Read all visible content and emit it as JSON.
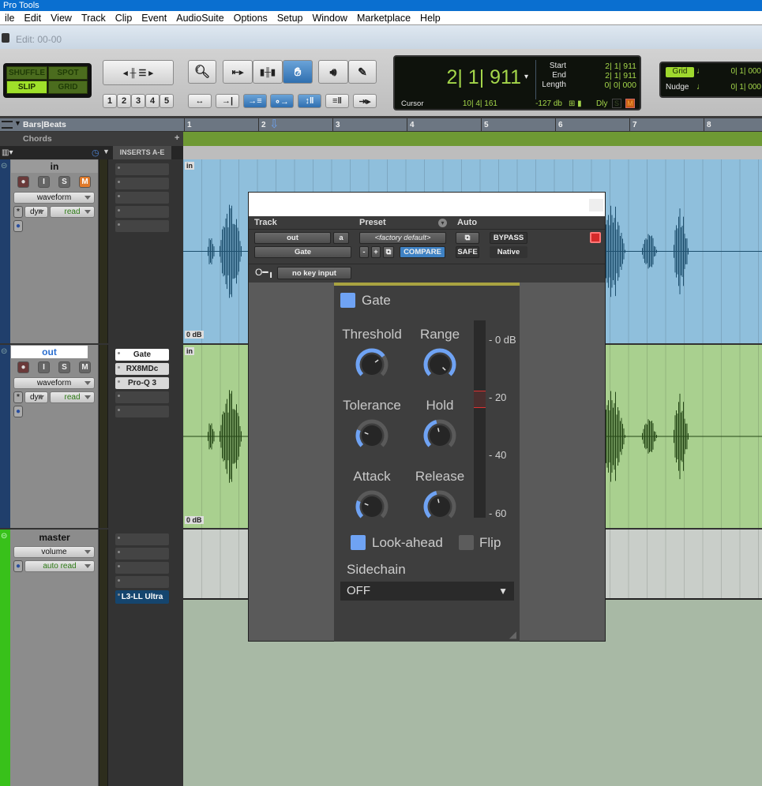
{
  "app": {
    "title": "Pro Tools",
    "window_title": "Edit: 00-00"
  },
  "menu": [
    "ile",
    "Edit",
    "View",
    "Track",
    "Clip",
    "Event",
    "AudioSuite",
    "Options",
    "Setup",
    "Window",
    "Marketplace",
    "Help"
  ],
  "toolbar": {
    "modes": {
      "shuffle": "SHUFFLE",
      "spot": "SPOT",
      "slip": "SLIP",
      "grid": "GRID",
      "active": "SLIP"
    },
    "zoom_presets": [
      "1",
      "2",
      "3",
      "4",
      "5"
    ],
    "tools": [
      "zoomer-icon",
      "trim-icon",
      "selector-icon",
      "grabber-icon",
      "scrubber-icon",
      "pencil-icon"
    ],
    "active_tool": "grabber-icon",
    "counter": {
      "main": "2| 1| 911",
      "start_label": "Start",
      "start": "2| 1| 911",
      "end_label": "End",
      "end": "2| 1| 911",
      "length_label": "Length",
      "length": "0| 0| 000",
      "cursor_label": "Cursor",
      "cursor": "10| 4| 161",
      "level": "-127 db",
      "dly": "Dly",
      "s": "S",
      "m": "M"
    },
    "grid": {
      "label": "Grid",
      "value": "0| 1| 000"
    },
    "nudge": {
      "label": "Nudge",
      "value": "0| 1| 000"
    }
  },
  "rulers": {
    "bars_label": "Bars|Beats",
    "chords_label": "Chords",
    "chords_add": "+",
    "bars": [
      "1",
      "2",
      "3",
      "4",
      "5",
      "6",
      "7",
      "8"
    ],
    "inserts_header": "INSERTS A-E"
  },
  "tracks": [
    {
      "name": "in",
      "view": "waveform",
      "dyn": "dyn",
      "auto": "read",
      "inserts": [
        "",
        "",
        "",
        "",
        ""
      ],
      "clip_label": "in",
      "gain": "0 dB",
      "color": "#8fbfdc",
      "wave": "#1d4f6e",
      "mute_on": true
    },
    {
      "name": "out",
      "view": "waveform",
      "dyn": "dyn",
      "auto": "read",
      "inserts": [
        "Gate",
        "RX8MDc",
        "Pro-Q 3",
        "",
        ""
      ],
      "clip_label": "in",
      "gain": "0 dB",
      "color": "#a9d08f",
      "wave": "#244615",
      "mute_on": false
    },
    {
      "name": "master",
      "view": "volume",
      "auto": "auto read",
      "inserts": [
        "",
        "",
        "",
        "",
        "L3-LL Ultra"
      ]
    }
  ],
  "plugin": {
    "track_label": "Track",
    "preset_label": "Preset",
    "auto_label": "Auto",
    "track": "out",
    "channel": "a",
    "plugin_name": "Gate",
    "preset": "<factory default>",
    "minus": "-",
    "plus": "+",
    "compare": "COMPARE",
    "safe": "SAFE",
    "bypass": "BYPASS",
    "native": "Native",
    "key_input": "no key input",
    "gate": {
      "enable_label": "Gate",
      "knobs": [
        {
          "label": "Threshold",
          "value": 0.7
        },
        {
          "label": "Range",
          "value": 1.0
        },
        {
          "label": "Tolerance",
          "value": 0.25
        },
        {
          "label": "Hold",
          "value": 0.45
        },
        {
          "label": "Attack",
          "value": 0.25
        },
        {
          "label": "Release",
          "value": 0.45
        }
      ],
      "meter_scale": [
        "- 0 dB",
        "- 20",
        "- 40",
        "- 60"
      ],
      "lookahead_label": "Look-ahead",
      "lookahead": true,
      "flip_label": "Flip",
      "flip": false,
      "sidechain_label": "Sidechain",
      "sidechain": "OFF"
    }
  }
}
